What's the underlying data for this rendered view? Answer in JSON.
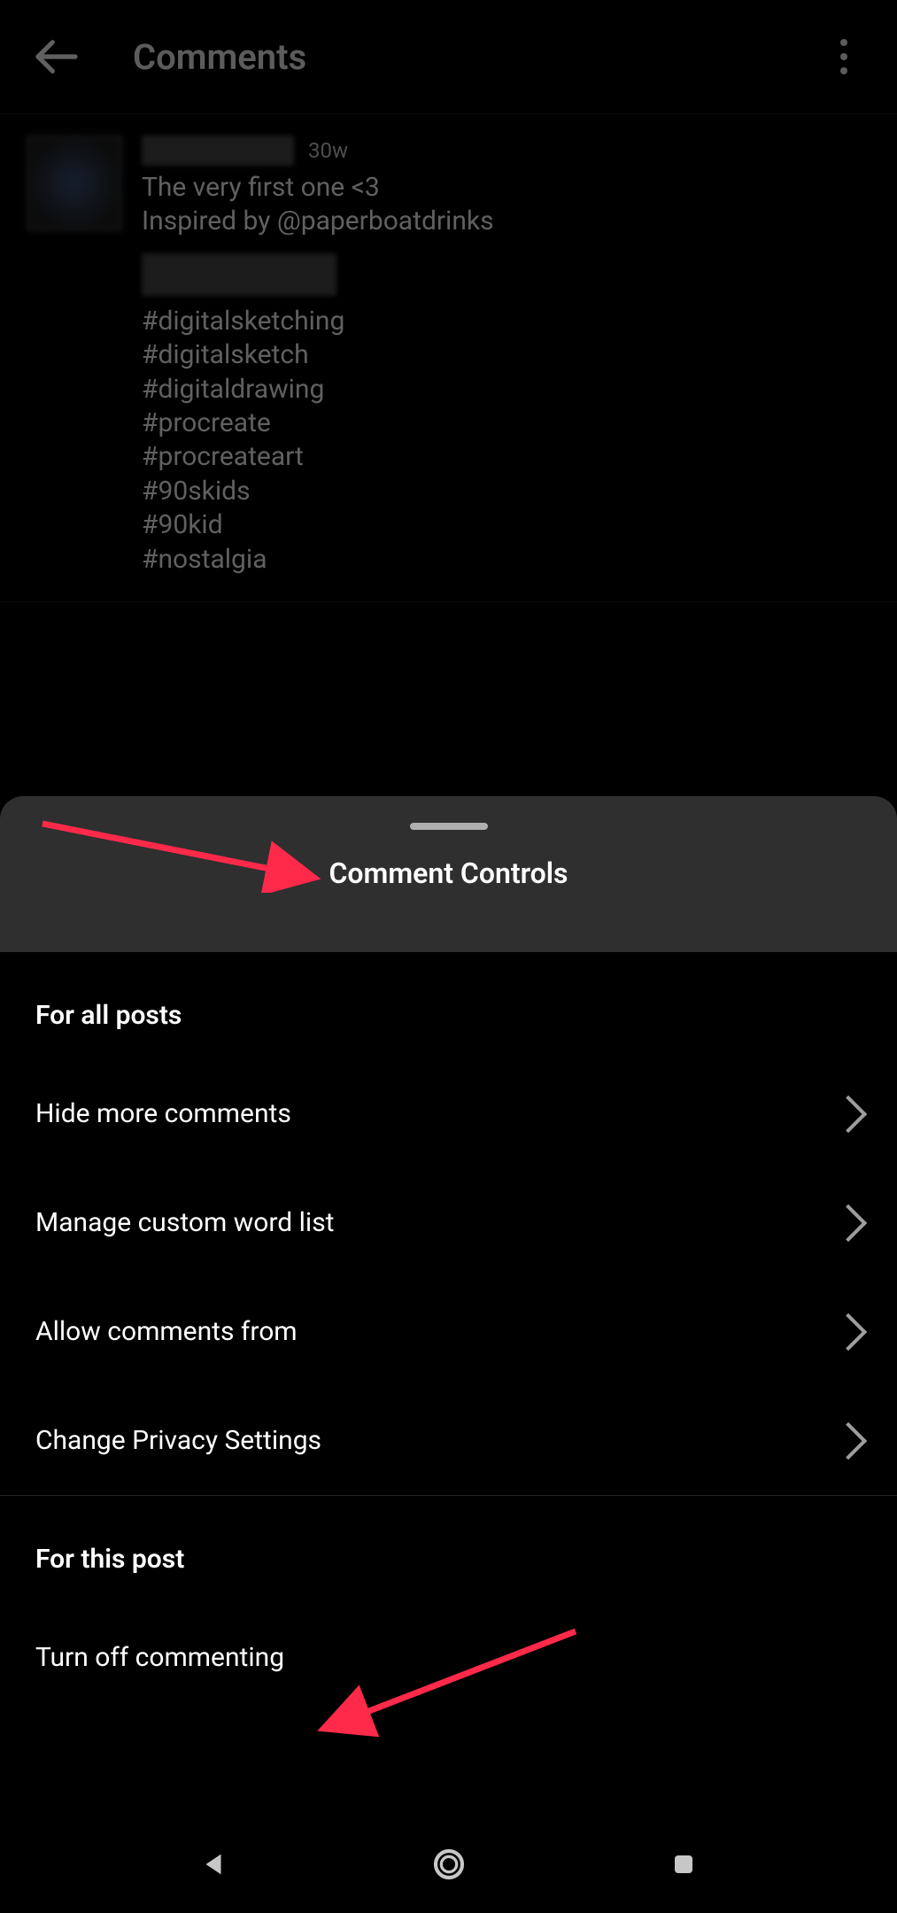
{
  "header": {
    "title": "Comments"
  },
  "post": {
    "timestamp": "30w",
    "caption_line1": "The very first one <3",
    "caption_line2": "Inspired by @paperboatdrinks",
    "hashtags": [
      "#digitalsketching",
      "#digitalsketch",
      "#digitaldrawing",
      "#procreate",
      "#procreateart",
      "#90skids",
      "#90kid",
      "#nostalgia"
    ]
  },
  "sheet": {
    "title": "Comment Controls",
    "section_all_label": "For all posts",
    "rows_all": [
      {
        "label": "Hide more comments"
      },
      {
        "label": "Manage custom word list"
      },
      {
        "label": "Allow comments from"
      },
      {
        "label": "Change Privacy Settings"
      }
    ],
    "section_this_label": "For this post",
    "rows_this": [
      {
        "label": "Turn off commenting"
      }
    ]
  }
}
